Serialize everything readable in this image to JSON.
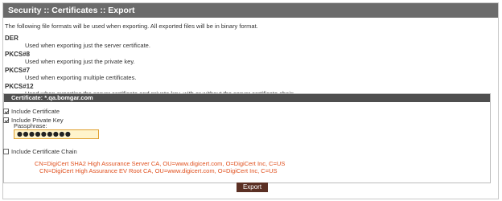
{
  "header": {
    "title": "Security :: Certificates :: Export"
  },
  "intro": "The following file formats will be used when exporting. All exported files will be in binary format.",
  "formats": [
    {
      "name": "DER",
      "desc": "Used when exporting just the server certificate."
    },
    {
      "name": "PKCS#8",
      "desc": "Used when exporting just the private key."
    },
    {
      "name": "PKCS#7",
      "desc": "Used when exporting multiple certificates."
    },
    {
      "name": "PKCS#12",
      "desc": "Used when exporting the server certificate and private key, with or without the server certificate chain."
    }
  ],
  "certificate": {
    "title": "Certificate: *.qa.bomgar.com",
    "include_certificate": {
      "label": "Include Certificate",
      "checked": true
    },
    "include_private_key": {
      "label": "Include Private Key",
      "checked": true
    },
    "passphrase_label": "Passphrase:",
    "passphrase_value": "●●●●●●●●●",
    "include_chain": {
      "label": "Include Certificate Chain",
      "checked": false
    },
    "chain": [
      "CN=DigiCert SHA2 High Assurance Server CA, OU=www.digicert.com, O=DigiCert Inc, C=US",
      "CN=DigiCert High Assurance EV Root CA, OU=www.digicert.com, O=DigiCert Inc, C=US"
    ]
  },
  "export_label": "Export",
  "colors": {
    "header": "#6b6b6b",
    "cert_title": "#4f4f4f",
    "chain_text": "#e0501e",
    "button": "#5b3024",
    "input_bg": "#fff4cc"
  }
}
